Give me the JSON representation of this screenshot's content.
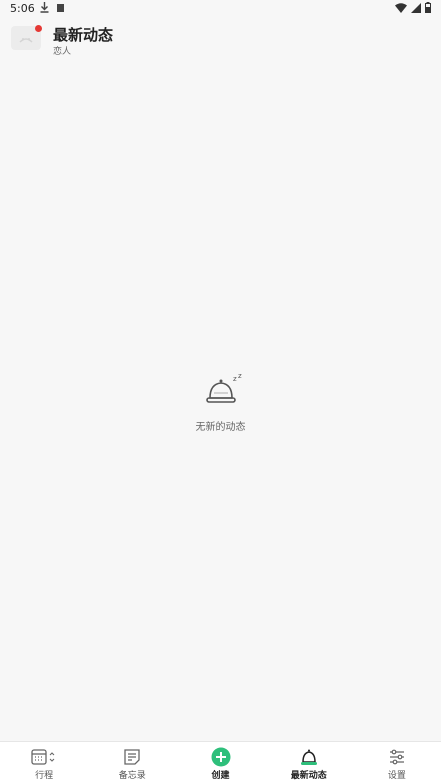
{
  "status_bar": {
    "time": "5:06"
  },
  "header": {
    "title": "最新动态",
    "subtitle": "恋人"
  },
  "empty_state": {
    "message": "无新的动态",
    "icon": "sleeping-bell-icon"
  },
  "bottom_nav": {
    "items": [
      {
        "label": "行程",
        "icon": "calendar-icon"
      },
      {
        "label": "备忘录",
        "icon": "notes-icon"
      },
      {
        "label": "创建",
        "icon": "add-circle-icon"
      },
      {
        "label": "最新动态",
        "icon": "bell-icon"
      },
      {
        "label": "设置",
        "icon": "sliders-icon"
      }
    ],
    "active": "最新动态"
  },
  "colors": {
    "accent": "#2ebf7b",
    "notification_dot": "#e53935",
    "background": "#f7f7f7"
  }
}
